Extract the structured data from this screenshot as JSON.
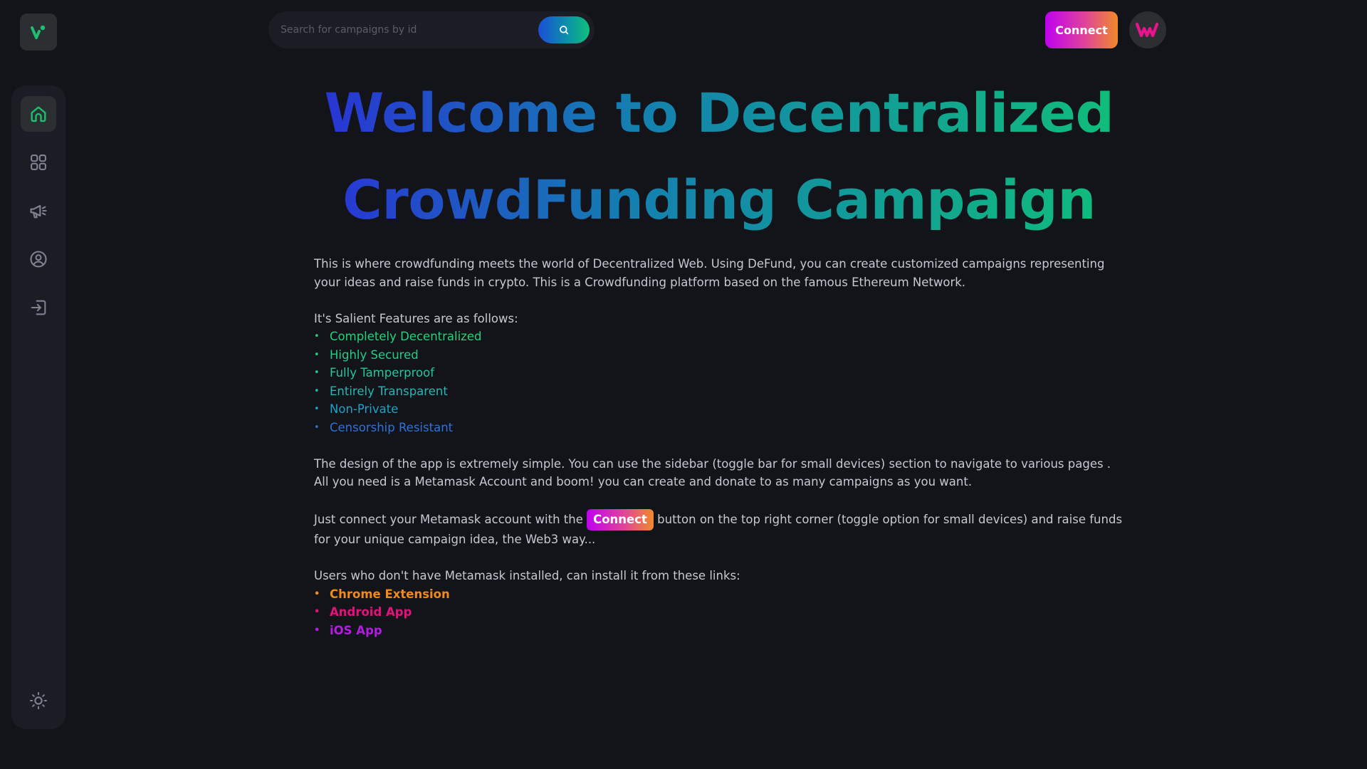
{
  "search": {
    "placeholder": "Search for campaigns by id"
  },
  "header": {
    "connect_label": "Connect"
  },
  "sidebar": {
    "items": [
      {
        "name": "dashboard",
        "icon": "home-icon",
        "active": true
      },
      {
        "name": "campaigns",
        "icon": "grid-icon",
        "active": false
      },
      {
        "name": "create-campaign",
        "icon": "megaphone-icon",
        "active": false
      },
      {
        "name": "profile",
        "icon": "user-circle-icon",
        "active": false
      },
      {
        "name": "logout",
        "icon": "logout-icon",
        "active": false
      }
    ],
    "theme_toggle_icon": "sun-icon"
  },
  "hero": {
    "title_line1": "Welcome to Decentralized",
    "title_line2": "CrowdFunding Campaign"
  },
  "body": {
    "intro": "This is where crowdfunding meets the world of Decentralized Web. Using DeFund, you can create customized campaigns representing your ideas and raise funds in crypto. This is a Crowdfunding platform based on the famous Ethereum Network.",
    "features_heading": "It's Salient Features are as follows:",
    "features": [
      "Completely Decentralized",
      "Highly Secured",
      "Fully Tamperproof",
      "Entirely Transparent",
      "Non-Private",
      "Censorship Resistant"
    ],
    "design_text": "The design of the app is extremely simple. You can use the sidebar (toggle bar for small devices) section to navigate to various pages . All you need is a Metamask Account and boom! you can create and donate to as many campaigns as you want.",
    "connect_before": "Just connect your Metamask account with the",
    "connect_badge": "Connect",
    "connect_after": "button on the top right corner (toggle option for small devices) and raise funds for your unique campaign idea, the Web3 way...",
    "install_heading": "Users who don't have Metamask installed, can install it from these links:",
    "links": [
      "Chrome Extension",
      "Android App",
      "iOS App"
    ]
  },
  "colors": {
    "background": "#13131a",
    "panel": "#1c1c24",
    "accent_green": "#10c07a",
    "accent_blue": "#1d4ed8",
    "connect_start": "#c000f0",
    "connect_end": "#f08a2a"
  }
}
